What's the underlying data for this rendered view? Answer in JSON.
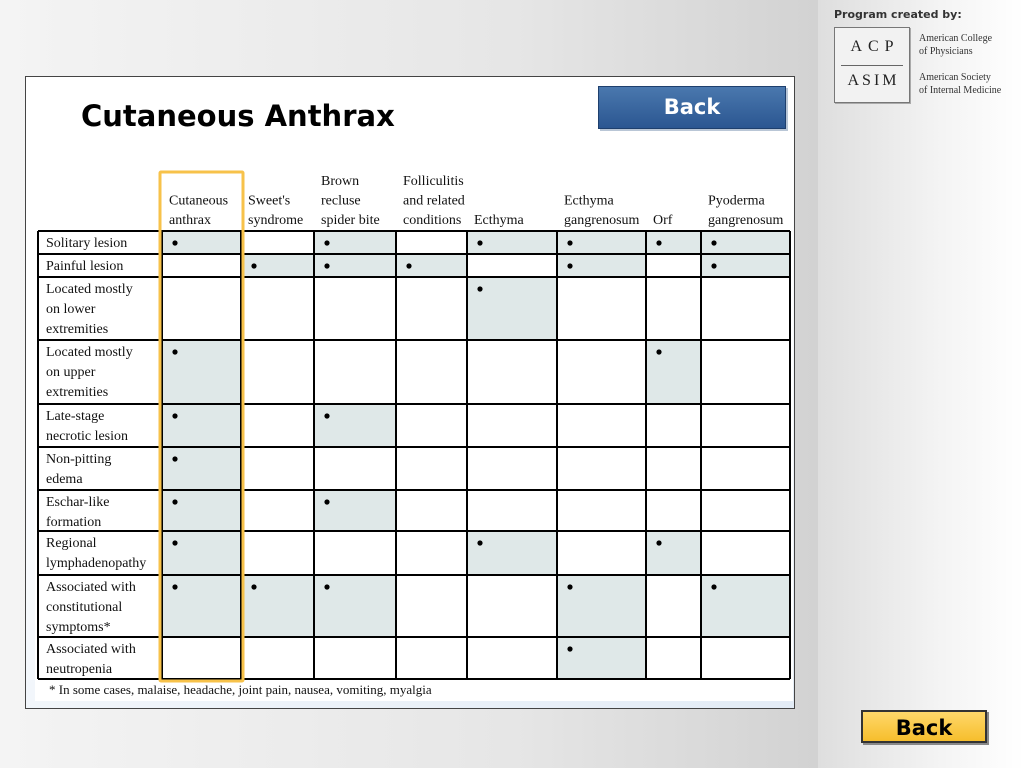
{
  "credits": {
    "heading": "Program created by:",
    "logo_top": "ACP",
    "logo_bottom": "ASIM",
    "org_acp_line1": "American College",
    "org_acp_line2": "of Physicians",
    "org_asim_line1": "American Society",
    "org_asim_line2": "of Internal Medicine"
  },
  "slide": {
    "title": "Cutaneous Anthrax",
    "back_label": "Back"
  },
  "table": {
    "highlight_color": "#f7c24a",
    "shade_color": "#dfe8e8",
    "columns": [
      [
        "Cutaneous",
        "anthrax"
      ],
      [
        "Sweet's",
        "syndrome"
      ],
      [
        "Brown",
        "recluse",
        "spider bite"
      ],
      [
        "Folliculitis",
        "and related",
        "conditions"
      ],
      [
        "Ecthyma"
      ],
      [
        "Ecthyma",
        "gangrenosum"
      ],
      [
        "Orf"
      ],
      [
        "Pyoderma",
        "gangrenosum"
      ]
    ],
    "rows": [
      {
        "label": [
          "Solitary lesion"
        ],
        "marks": [
          1,
          0,
          1,
          0,
          1,
          1,
          1,
          1
        ]
      },
      {
        "label": [
          "Painful lesion"
        ],
        "marks": [
          0,
          1,
          1,
          1,
          0,
          1,
          0,
          1
        ]
      },
      {
        "label": [
          "Located mostly",
          " on lower",
          "extremities"
        ],
        "marks": [
          0,
          0,
          0,
          0,
          1,
          0,
          0,
          0
        ]
      },
      {
        "label": [
          "Located mostly",
          "on upper",
          "extremities"
        ],
        "marks": [
          1,
          0,
          0,
          0,
          0,
          0,
          1,
          0
        ]
      },
      {
        "label": [
          "Late-stage",
          "necrotic lesion"
        ],
        "marks": [
          1,
          0,
          1,
          0,
          0,
          0,
          0,
          0
        ]
      },
      {
        "label": [
          "Non-pitting",
          "edema"
        ],
        "marks": [
          1,
          0,
          0,
          0,
          0,
          0,
          0,
          0
        ]
      },
      {
        "label": [
          "Eschar-like",
          "formation"
        ],
        "marks": [
          1,
          0,
          1,
          0,
          0,
          0,
          0,
          0
        ]
      },
      {
        "label": [
          "Regional",
          "lymphadenopathy"
        ],
        "marks": [
          1,
          0,
          0,
          0,
          1,
          0,
          1,
          0
        ]
      },
      {
        "label": [
          "Associated with",
          "constitutional",
          "symptoms*"
        ],
        "marks": [
          1,
          1,
          1,
          0,
          0,
          1,
          0,
          1
        ]
      },
      {
        "label": [
          "Associated with",
          "neutropenia"
        ],
        "marks": [
          0,
          0,
          0,
          0,
          0,
          1,
          0,
          0
        ]
      }
    ],
    "footnote": "* In some cases, malaise, headache, joint pain, nausea, vomiting, myalgia"
  },
  "nav": {
    "back_label": "Back"
  }
}
